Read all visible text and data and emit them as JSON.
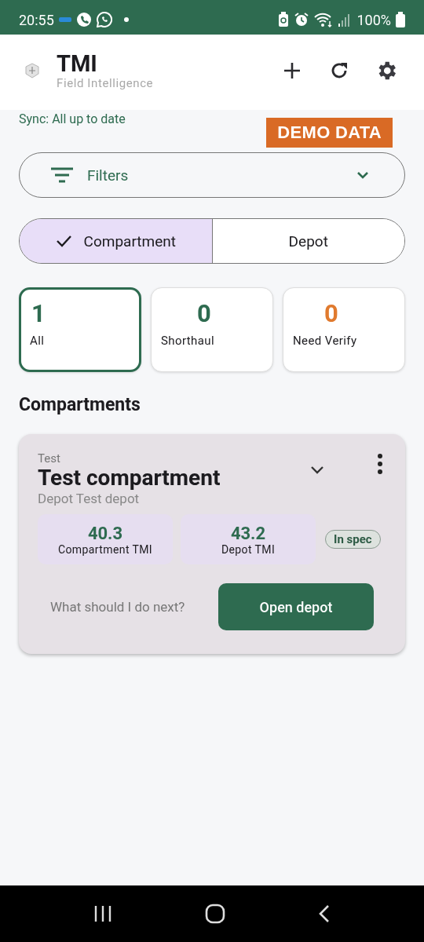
{
  "status_bar": {
    "time": "20:55",
    "battery": "100%"
  },
  "app_bar": {
    "title": "TMI",
    "subtitle": "Field Intelligence"
  },
  "sync": "Sync: All up to date",
  "badge": "DEMO DATA",
  "filters": {
    "label": "Filters",
    "expanded": false
  },
  "segments": [
    {
      "label": "Compartment",
      "selected": true
    },
    {
      "label": "Depot",
      "selected": false
    }
  ],
  "stats": [
    {
      "count": "1",
      "label": "All",
      "selected": true,
      "color": "#2e6b50"
    },
    {
      "count": "0",
      "label": "Shorthaul",
      "selected": false,
      "color": "#2e6b50"
    },
    {
      "count": "0",
      "label": "Need Verify",
      "selected": false,
      "color": "#e07a2e"
    }
  ],
  "section_title": "Compartments",
  "compartments": [
    {
      "overline": "Test",
      "title": "Test compartment",
      "subtitle": "Depot Test depot",
      "metrics": [
        {
          "value": "40.3",
          "label": "Compartment TMI"
        },
        {
          "value": "43.2",
          "label": "Depot TMI"
        }
      ],
      "status": "In spec",
      "hint": "What should I do next?",
      "action": "Open depot"
    }
  ]
}
